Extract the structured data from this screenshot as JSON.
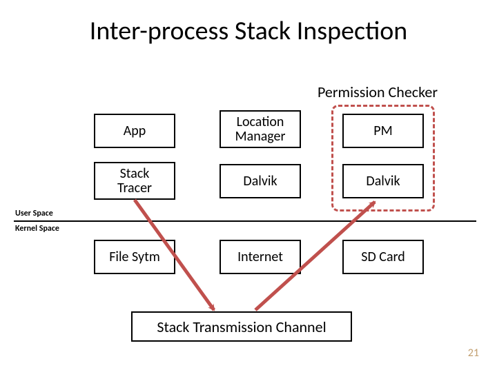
{
  "title": "Inter-process Stack Inspection",
  "perm_checker_label": "Permission Checker",
  "boxes": {
    "app": "App",
    "stack_tracer": "Stack\nTracer",
    "location_manager": "Location\nManager",
    "dalvik1": "Dalvik",
    "pm": "PM",
    "dalvik2": "Dalvik",
    "file_system": "File Sytm",
    "internet": "Internet",
    "sd_card": "SD Card"
  },
  "space_labels": {
    "user": "User Space",
    "kernel": "Kernel Space"
  },
  "channel": "Stack Transmission Channel",
  "page_number": "21",
  "arrows": {
    "stacktracer_to_channel_color": "#c0504d",
    "channel_to_dalvik2_color": "#c0504d"
  }
}
